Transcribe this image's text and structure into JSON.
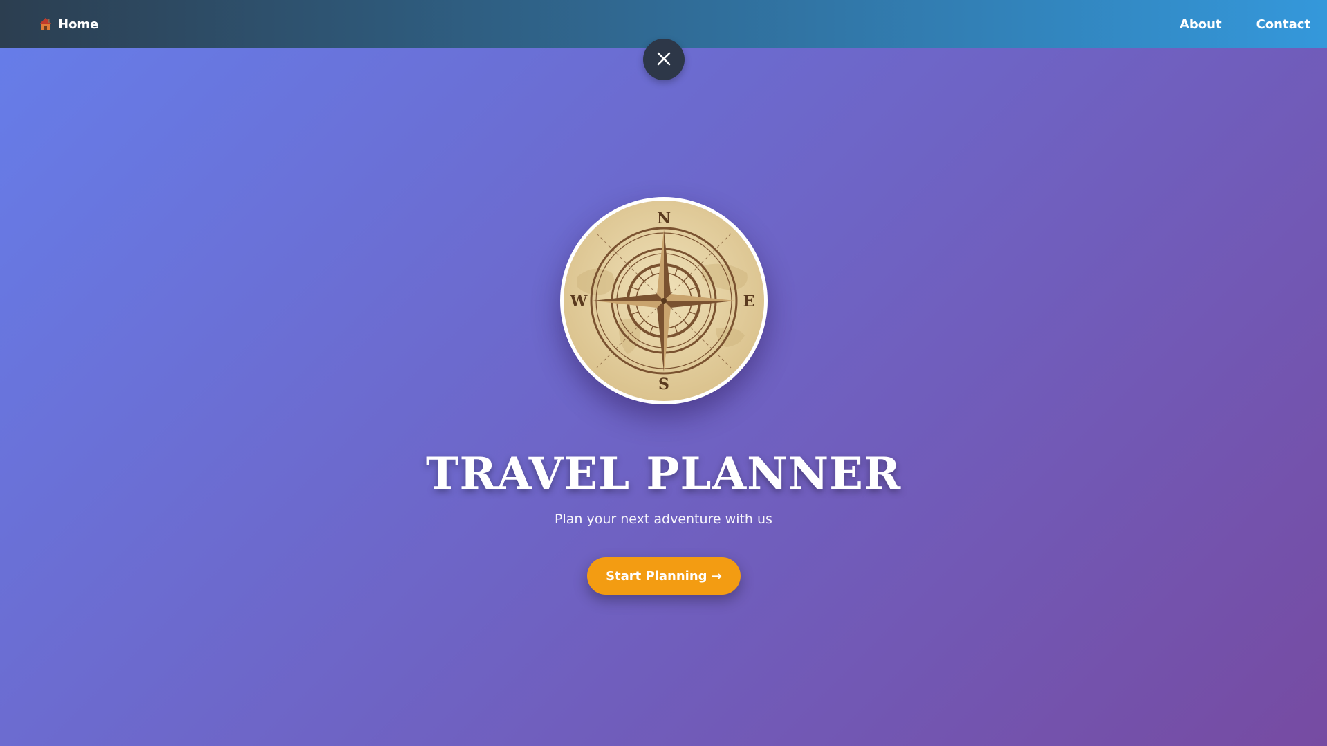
{
  "nav": {
    "home_label": "Home",
    "home_icon": "house-icon",
    "links": [
      "About",
      "Contact"
    ]
  },
  "close_button": {
    "icon": "close-icon"
  },
  "hero": {
    "compass_letters": {
      "north": "N",
      "south": "S",
      "east": "E",
      "west": "W"
    },
    "title": "TRAVEL PLANNER",
    "subtitle": "Plan your next adventure with us",
    "cta_label": "Start Planning →"
  },
  "colors": {
    "nav_gradient_start": "#2c3e50",
    "nav_gradient_end": "#3498db",
    "bg_gradient_start": "#667eea",
    "bg_gradient_end": "#764ba2",
    "cta": "#f39c12",
    "close_button": "#2d3748",
    "compass_parchment": "#e6d3a3",
    "compass_brown": "#7a5230"
  }
}
